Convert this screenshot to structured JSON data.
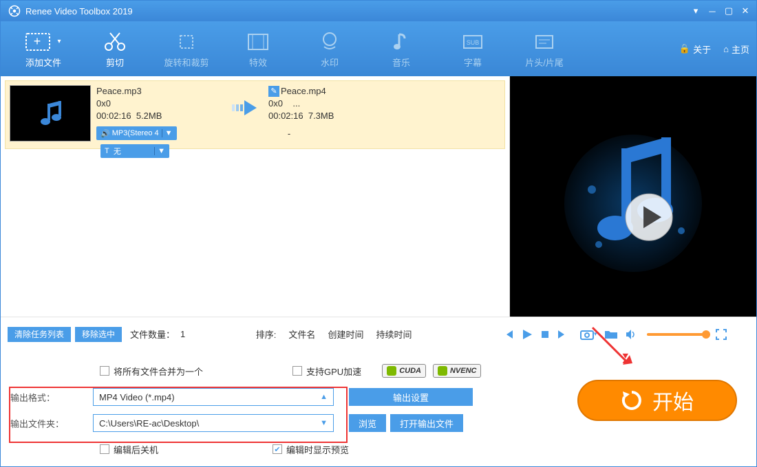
{
  "title": "Renee Video Toolbox 2019",
  "header": {
    "about": "关于",
    "home": "主页"
  },
  "toolbar": [
    {
      "k": "add",
      "t": "添加文件",
      "en": true
    },
    {
      "k": "cut",
      "t": "剪切",
      "en": true
    },
    {
      "k": "crop",
      "t": "旋转和裁剪",
      "en": false
    },
    {
      "k": "fx",
      "t": "特效",
      "en": false
    },
    {
      "k": "wm",
      "t": "水印",
      "en": false
    },
    {
      "k": "audio",
      "t": "音乐",
      "en": false
    },
    {
      "k": "sub",
      "t": "字幕",
      "en": false
    },
    {
      "k": "intro",
      "t": "片头/片尾",
      "en": false
    }
  ],
  "item": {
    "src": {
      "name": "Peace.mp3",
      "dim": "0x0",
      "dur": "00:02:16",
      "size": "5.2MB"
    },
    "dst": {
      "name": "Peace.mp4",
      "dim": "0x0",
      "ext": "...",
      "dur": "00:02:16",
      "size": "7.3MB"
    },
    "fmtPill": "MP3(Stereo 4",
    "subPill": "无",
    "dash": "-"
  },
  "ctrl": {
    "clear": "清除任务列表",
    "remove": "移除选中",
    "countLbl": "文件数量：",
    "count": "1",
    "sortLbl": "排序:",
    "s1": "文件名",
    "s2": "创建时间",
    "s3": "持续时间"
  },
  "opts": {
    "mergeLbl": "将所有文件合并为一个",
    "gpuLbl": "支持GPU加速",
    "cuda": "CUDA",
    "nvenc": "NVENC",
    "outFmtLbl": "输出格式：",
    "outFmt": "MP4 Video (*.mp4)",
    "outSet": "输出设置",
    "outDirLbl": "输出文件夹：",
    "outDir": "C:\\Users\\RE-ac\\Desktop\\",
    "browse": "浏览",
    "openOut": "打开输出文件",
    "shutdown": "编辑后关机",
    "previewAfter": "编辑时显示预览"
  },
  "start": "开始"
}
